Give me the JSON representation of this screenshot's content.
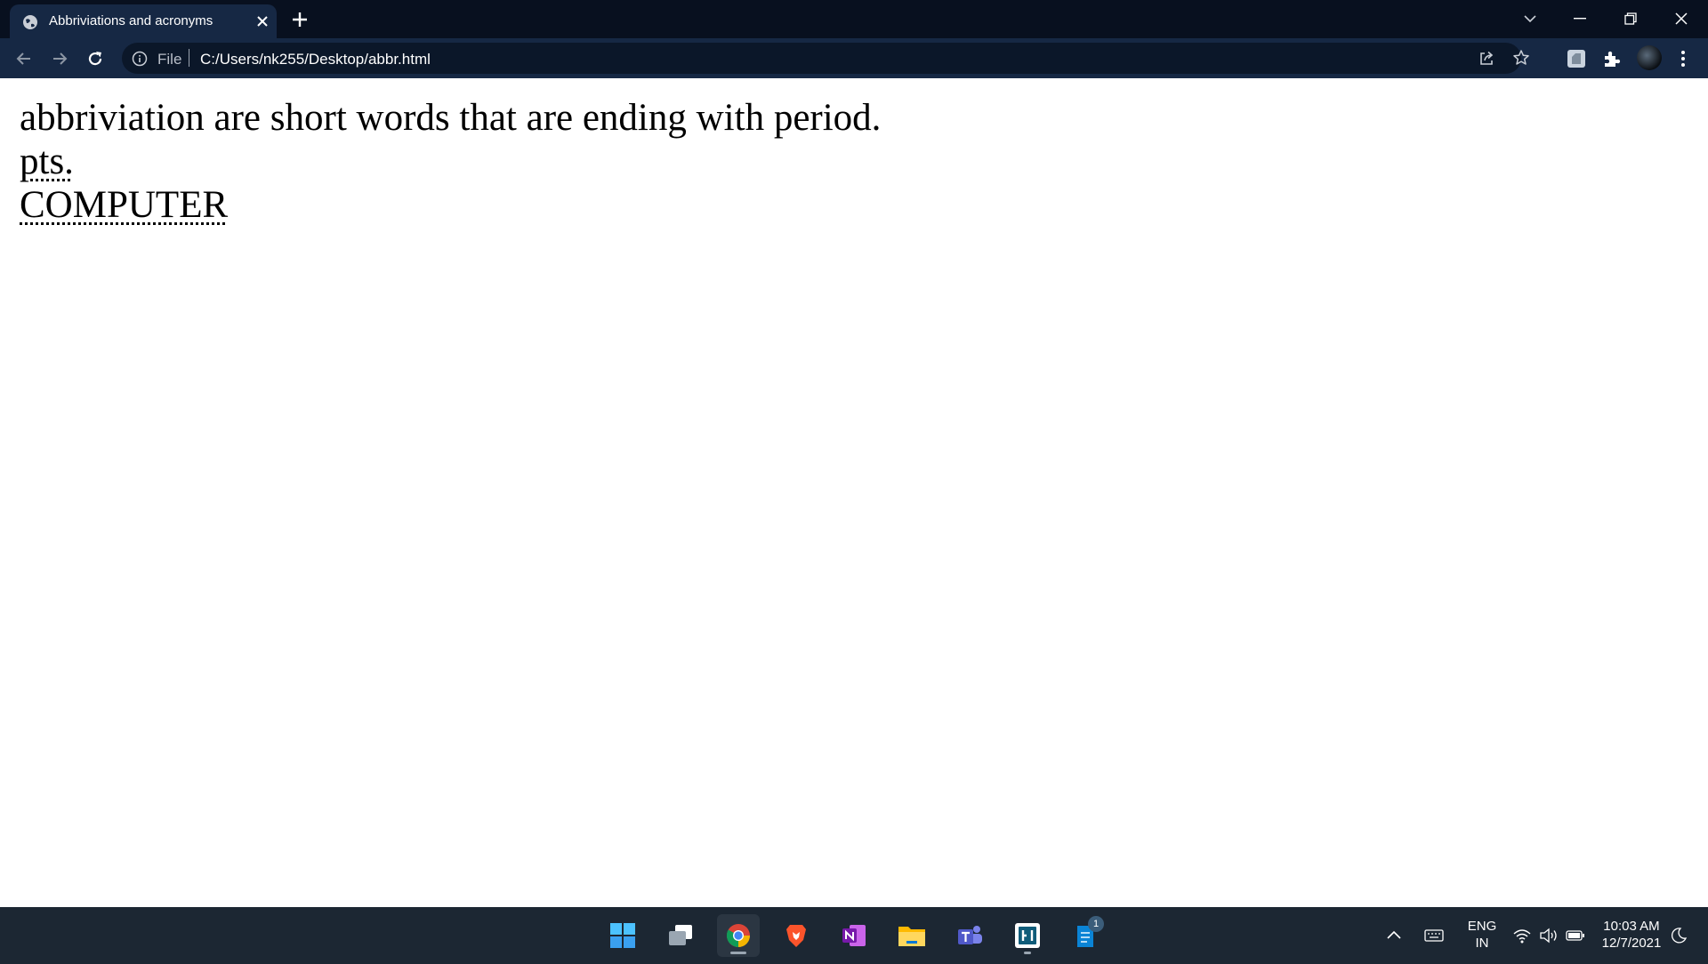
{
  "browser": {
    "tab_title": "Abbriviations and acronyms",
    "address": {
      "scheme_label": "File",
      "url": "C:/Users/nk255/Desktop/abbr.html"
    }
  },
  "page": {
    "line1": "abbriviation are short words that are ending with period.",
    "abbr1": "pts.",
    "abbr2": "COMPUTER"
  },
  "taskbar": {
    "apps": [
      "start-icon",
      "task-view-icon",
      "chrome-icon",
      "brave-icon",
      "onenote-icon",
      "file-explorer-icon",
      "teams-icon",
      "snipping-tool-icon",
      "notepad-icon"
    ],
    "notepad_badge": "1",
    "language_line1": "ENG",
    "language_line2": "IN",
    "time": "10:03 AM",
    "date": "12/7/2021"
  },
  "colors": {
    "tabstrip": "#08101f",
    "toolbar": "#162844",
    "omnibox": "#0b1729",
    "taskbar": "#1c2733"
  }
}
